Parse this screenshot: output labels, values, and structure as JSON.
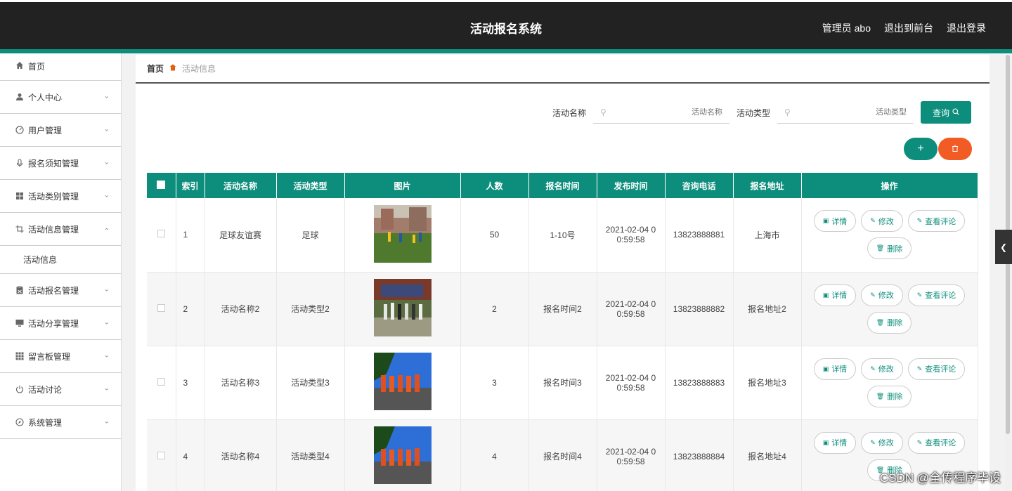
{
  "header": {
    "title": "活动报名系统",
    "user": "管理员 abo",
    "exit_front": "退出到前台",
    "logout": "退出登录"
  },
  "sidebar": {
    "items": [
      {
        "label": "首页",
        "icon": "home-icon"
      },
      {
        "label": "个人中心",
        "icon": "user-icon"
      },
      {
        "label": "用户管理",
        "icon": "gauge-icon"
      },
      {
        "label": "报名须知管理",
        "icon": "mic-icon"
      },
      {
        "label": "活动类别管理",
        "icon": "grid-icon"
      },
      {
        "label": "活动信息管理",
        "icon": "crop-icon"
      },
      {
        "label": "活动报名管理",
        "icon": "clipboard-icon"
      },
      {
        "label": "活动分享管理",
        "icon": "monitor-icon"
      },
      {
        "label": "留言板管理",
        "icon": "apps-icon"
      },
      {
        "label": "活动讨论",
        "icon": "power-icon"
      },
      {
        "label": "系统管理",
        "icon": "compass-icon"
      }
    ],
    "sub_active": "活动信息"
  },
  "breadcrumb": {
    "home": "首页",
    "current": "活动信息"
  },
  "search": {
    "name_label": "活动名称",
    "name_placeholder": "活动名称",
    "type_label": "活动类型",
    "type_placeholder": "活动类型",
    "query_label": "查询"
  },
  "table": {
    "headers": [
      "索引",
      "活动名称",
      "活动类型",
      "图片",
      "人数",
      "报名时间",
      "发布时间",
      "咨询电话",
      "报名地址",
      "操作"
    ],
    "rows": [
      {
        "idx": "1",
        "name": "足球友谊赛",
        "type": "足球",
        "count": "50",
        "signup": "1-10号",
        "publish_1": "2021-02-04 0",
        "publish_2": "0:59:58",
        "phone": "13823888881",
        "address": "上海市"
      },
      {
        "idx": "2",
        "name": "活动名称2",
        "type": "活动类型2",
        "count": "2",
        "signup": "报名时间2",
        "publish_1": "2021-02-04 0",
        "publish_2": "0:59:58",
        "phone": "13823888882",
        "address": "报名地址2"
      },
      {
        "idx": "3",
        "name": "活动名称3",
        "type": "活动类型3",
        "count": "3",
        "signup": "报名时间3",
        "publish_1": "2021-02-04 0",
        "publish_2": "0:59:58",
        "phone": "13823888883",
        "address": "报名地址3"
      },
      {
        "idx": "4",
        "name": "活动名称4",
        "type": "活动类型4",
        "count": "4",
        "signup": "报名时间4",
        "publish_1": "2021-02-04 0",
        "publish_2": "0:59:58",
        "phone": "13823888884",
        "address": "报名地址4"
      }
    ],
    "ops": {
      "detail": "详情",
      "edit": "修改",
      "comments": "查看评论",
      "delete": "删除"
    }
  },
  "watermark": "CSDN @全传程序毕设",
  "colors": {
    "accent": "#0d8e7c",
    "danger": "#f25b24",
    "topbar": "#222222"
  }
}
